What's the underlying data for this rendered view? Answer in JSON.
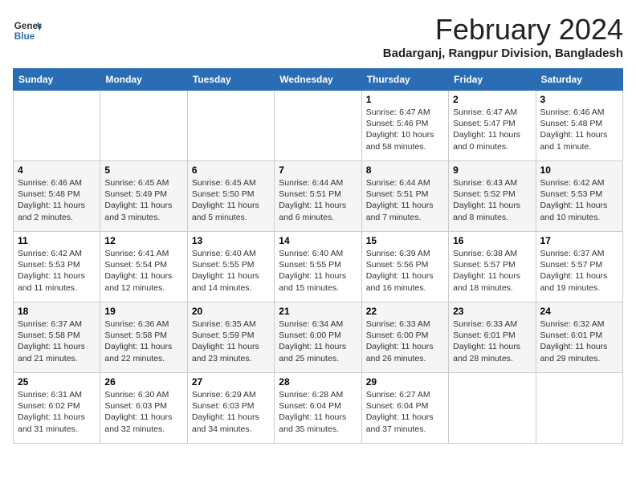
{
  "header": {
    "logo_general": "General",
    "logo_blue": "Blue",
    "title": "February 2024",
    "subtitle": "Badarganj, Rangpur Division, Bangladesh"
  },
  "weekdays": [
    "Sunday",
    "Monday",
    "Tuesday",
    "Wednesday",
    "Thursday",
    "Friday",
    "Saturday"
  ],
  "weeks": [
    [
      {
        "day": "",
        "info": ""
      },
      {
        "day": "",
        "info": ""
      },
      {
        "day": "",
        "info": ""
      },
      {
        "day": "",
        "info": ""
      },
      {
        "day": "1",
        "info": "Sunrise: 6:47 AM\nSunset: 5:46 PM\nDaylight: 10 hours\nand 58 minutes."
      },
      {
        "day": "2",
        "info": "Sunrise: 6:47 AM\nSunset: 5:47 PM\nDaylight: 11 hours\nand 0 minutes."
      },
      {
        "day": "3",
        "info": "Sunrise: 6:46 AM\nSunset: 5:48 PM\nDaylight: 11 hours\nand 1 minute."
      }
    ],
    [
      {
        "day": "4",
        "info": "Sunrise: 6:46 AM\nSunset: 5:48 PM\nDaylight: 11 hours\nand 2 minutes."
      },
      {
        "day": "5",
        "info": "Sunrise: 6:45 AM\nSunset: 5:49 PM\nDaylight: 11 hours\nand 3 minutes."
      },
      {
        "day": "6",
        "info": "Sunrise: 6:45 AM\nSunset: 5:50 PM\nDaylight: 11 hours\nand 5 minutes."
      },
      {
        "day": "7",
        "info": "Sunrise: 6:44 AM\nSunset: 5:51 PM\nDaylight: 11 hours\nand 6 minutes."
      },
      {
        "day": "8",
        "info": "Sunrise: 6:44 AM\nSunset: 5:51 PM\nDaylight: 11 hours\nand 7 minutes."
      },
      {
        "day": "9",
        "info": "Sunrise: 6:43 AM\nSunset: 5:52 PM\nDaylight: 11 hours\nand 8 minutes."
      },
      {
        "day": "10",
        "info": "Sunrise: 6:42 AM\nSunset: 5:53 PM\nDaylight: 11 hours\nand 10 minutes."
      }
    ],
    [
      {
        "day": "11",
        "info": "Sunrise: 6:42 AM\nSunset: 5:53 PM\nDaylight: 11 hours\nand 11 minutes."
      },
      {
        "day": "12",
        "info": "Sunrise: 6:41 AM\nSunset: 5:54 PM\nDaylight: 11 hours\nand 12 minutes."
      },
      {
        "day": "13",
        "info": "Sunrise: 6:40 AM\nSunset: 5:55 PM\nDaylight: 11 hours\nand 14 minutes."
      },
      {
        "day": "14",
        "info": "Sunrise: 6:40 AM\nSunset: 5:55 PM\nDaylight: 11 hours\nand 15 minutes."
      },
      {
        "day": "15",
        "info": "Sunrise: 6:39 AM\nSunset: 5:56 PM\nDaylight: 11 hours\nand 16 minutes."
      },
      {
        "day": "16",
        "info": "Sunrise: 6:38 AM\nSunset: 5:57 PM\nDaylight: 11 hours\nand 18 minutes."
      },
      {
        "day": "17",
        "info": "Sunrise: 6:37 AM\nSunset: 5:57 PM\nDaylight: 11 hours\nand 19 minutes."
      }
    ],
    [
      {
        "day": "18",
        "info": "Sunrise: 6:37 AM\nSunset: 5:58 PM\nDaylight: 11 hours\nand 21 minutes."
      },
      {
        "day": "19",
        "info": "Sunrise: 6:36 AM\nSunset: 5:58 PM\nDaylight: 11 hours\nand 22 minutes."
      },
      {
        "day": "20",
        "info": "Sunrise: 6:35 AM\nSunset: 5:59 PM\nDaylight: 11 hours\nand 23 minutes."
      },
      {
        "day": "21",
        "info": "Sunrise: 6:34 AM\nSunset: 6:00 PM\nDaylight: 11 hours\nand 25 minutes."
      },
      {
        "day": "22",
        "info": "Sunrise: 6:33 AM\nSunset: 6:00 PM\nDaylight: 11 hours\nand 26 minutes."
      },
      {
        "day": "23",
        "info": "Sunrise: 6:33 AM\nSunset: 6:01 PM\nDaylight: 11 hours\nand 28 minutes."
      },
      {
        "day": "24",
        "info": "Sunrise: 6:32 AM\nSunset: 6:01 PM\nDaylight: 11 hours\nand 29 minutes."
      }
    ],
    [
      {
        "day": "25",
        "info": "Sunrise: 6:31 AM\nSunset: 6:02 PM\nDaylight: 11 hours\nand 31 minutes."
      },
      {
        "day": "26",
        "info": "Sunrise: 6:30 AM\nSunset: 6:03 PM\nDaylight: 11 hours\nand 32 minutes."
      },
      {
        "day": "27",
        "info": "Sunrise: 6:29 AM\nSunset: 6:03 PM\nDaylight: 11 hours\nand 34 minutes."
      },
      {
        "day": "28",
        "info": "Sunrise: 6:28 AM\nSunset: 6:04 PM\nDaylight: 11 hours\nand 35 minutes."
      },
      {
        "day": "29",
        "info": "Sunrise: 6:27 AM\nSunset: 6:04 PM\nDaylight: 11 hours\nand 37 minutes."
      },
      {
        "day": "",
        "info": ""
      },
      {
        "day": "",
        "info": ""
      }
    ]
  ]
}
